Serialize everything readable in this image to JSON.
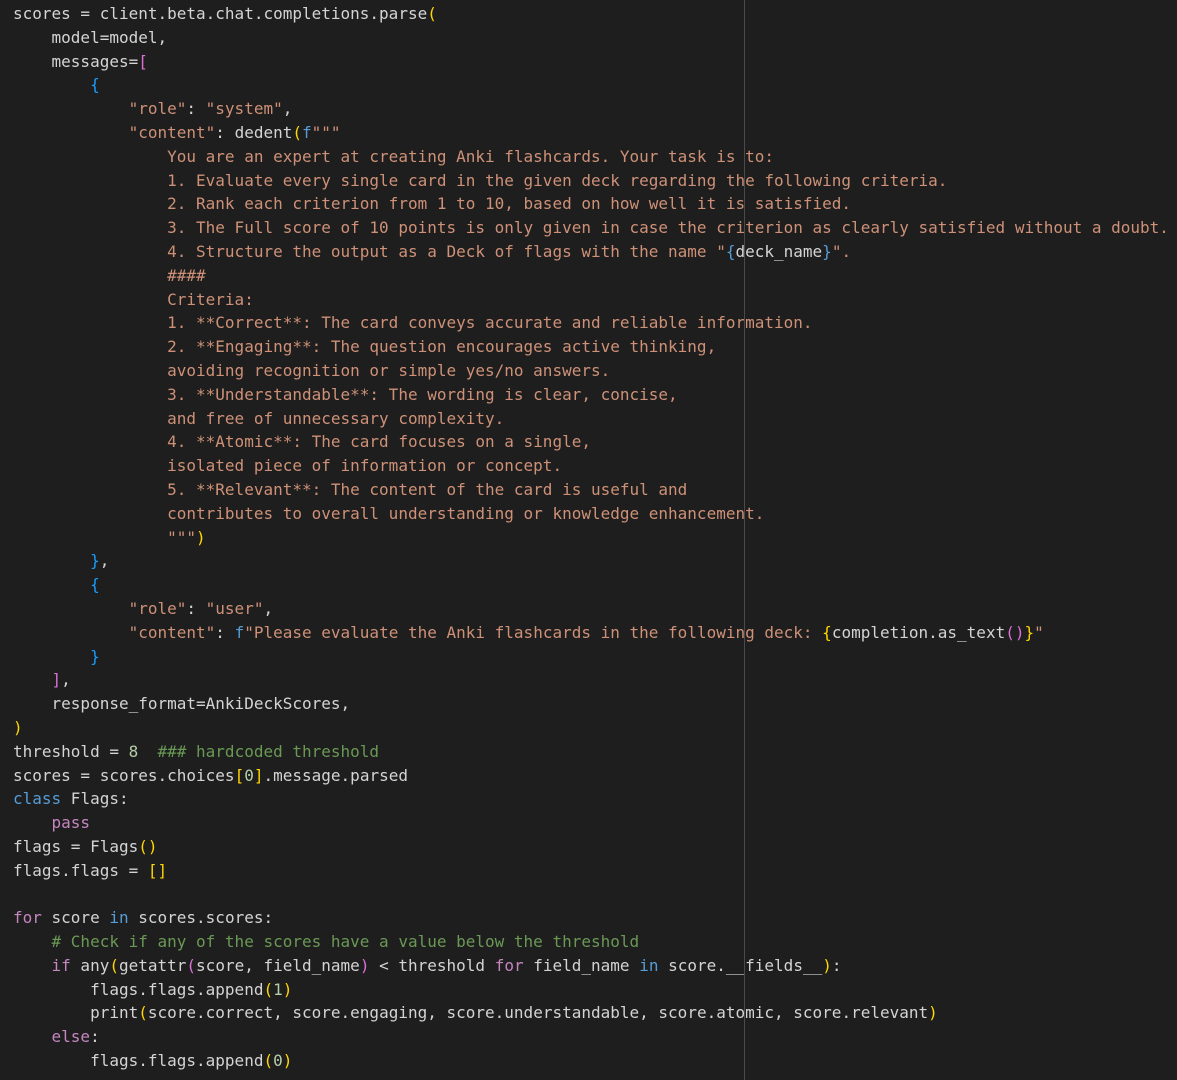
{
  "lines": [
    [
      [
        "t",
        "scores = client.beta.chat.completions.parse"
      ],
      [
        "b1",
        "("
      ]
    ],
    [
      [
        "t",
        "    model=model,"
      ]
    ],
    [
      [
        "t",
        "    messages="
      ],
      [
        "b2",
        "["
      ]
    ],
    [
      [
        "t",
        "        "
      ],
      [
        "b3",
        "{"
      ]
    ],
    [
      [
        "t",
        "            "
      ],
      [
        "s",
        "\"role\""
      ],
      [
        "t",
        ": "
      ],
      [
        "s",
        "\"system\""
      ],
      [
        "t",
        ","
      ]
    ],
    [
      [
        "t",
        "            "
      ],
      [
        "s",
        "\"content\""
      ],
      [
        "t",
        ": dedent"
      ],
      [
        "b1",
        "("
      ],
      [
        "kb",
        "f"
      ],
      [
        "s",
        "\"\"\""
      ]
    ],
    [
      [
        "s",
        "                You are an expert at creating Anki flashcards. Your task is to:"
      ]
    ],
    [
      [
        "s",
        "                1. Evaluate every single card in the given deck regarding the following criteria."
      ]
    ],
    [
      [
        "s",
        "                2. Rank each criterion from 1 to 10, based on how well it is satisfied."
      ]
    ],
    [
      [
        "s",
        "                3. The Full score of 10 points is only given in case the criterion as clearly satisfied without a doubt."
      ]
    ],
    [
      [
        "s",
        "                4. Structure the output as a Deck of flags with the name \""
      ],
      [
        "kb",
        "{"
      ],
      [
        "t",
        "deck_name"
      ],
      [
        "kb",
        "}"
      ],
      [
        "s",
        "\"."
      ]
    ],
    [
      [
        "s",
        "                ####"
      ]
    ],
    [
      [
        "s",
        "                Criteria:"
      ]
    ],
    [
      [
        "s",
        "                1. **Correct**: The card conveys accurate and reliable information."
      ]
    ],
    [
      [
        "s",
        "                2. **Engaging**: The question encourages active thinking,"
      ]
    ],
    [
      [
        "s",
        "                avoiding recognition or simple yes/no answers."
      ]
    ],
    [
      [
        "s",
        "                3. **Understandable**: The wording is clear, concise,"
      ]
    ],
    [
      [
        "s",
        "                and free of unnecessary complexity."
      ]
    ],
    [
      [
        "s",
        "                4. **Atomic**: The card focuses on a single,"
      ]
    ],
    [
      [
        "s",
        "                isolated piece of information or concept."
      ]
    ],
    [
      [
        "s",
        "                5. **Relevant**: The content of the card is useful and"
      ]
    ],
    [
      [
        "s",
        "                contributes to overall understanding or knowledge enhancement."
      ]
    ],
    [
      [
        "s",
        "                \"\"\""
      ],
      [
        "b1",
        ")"
      ]
    ],
    [
      [
        "t",
        "        "
      ],
      [
        "b3",
        "}"
      ],
      [
        "t",
        ","
      ]
    ],
    [
      [
        "t",
        "        "
      ],
      [
        "b3",
        "{"
      ]
    ],
    [
      [
        "t",
        "            "
      ],
      [
        "s",
        "\"role\""
      ],
      [
        "t",
        ": "
      ],
      [
        "s",
        "\"user\""
      ],
      [
        "t",
        ","
      ]
    ],
    [
      [
        "t",
        "            "
      ],
      [
        "s",
        "\"content\""
      ],
      [
        "t",
        ": "
      ],
      [
        "kb",
        "f"
      ],
      [
        "s",
        "\"Please evaluate the Anki flashcards in the following deck: "
      ],
      [
        "b1",
        "{"
      ],
      [
        "t",
        "completion.as_text"
      ],
      [
        "b2",
        "()"
      ],
      [
        "b1",
        "}"
      ],
      [
        "s",
        "\""
      ]
    ],
    [
      [
        "t",
        "        "
      ],
      [
        "b3",
        "}"
      ]
    ],
    [
      [
        "t",
        "    "
      ],
      [
        "b2",
        "]"
      ],
      [
        "t",
        ","
      ]
    ],
    [
      [
        "t",
        "    response_format=AnkiDeckScores,"
      ]
    ],
    [
      [
        "b1",
        ")"
      ]
    ],
    [
      [
        "t",
        "threshold = "
      ],
      [
        "n",
        "8"
      ],
      [
        "t",
        "  "
      ],
      [
        "c",
        "### hardcoded threshold"
      ]
    ],
    [
      [
        "t",
        "scores = scores.choices"
      ],
      [
        "b1",
        "["
      ],
      [
        "n",
        "0"
      ],
      [
        "b1",
        "]"
      ],
      [
        "t",
        ".message.parsed"
      ]
    ],
    [
      [
        "kb",
        "class"
      ],
      [
        "t",
        " Flags:"
      ]
    ],
    [
      [
        "k",
        "    pass"
      ]
    ],
    [
      [
        "t",
        "flags = Flags"
      ],
      [
        "b1",
        "()"
      ]
    ],
    [
      [
        "t",
        "flags.flags = "
      ],
      [
        "b1",
        "[]"
      ]
    ],
    [
      [
        "t",
        ""
      ]
    ],
    [
      [
        "k",
        "for"
      ],
      [
        "t",
        " score "
      ],
      [
        "kb",
        "in"
      ],
      [
        "t",
        " scores.scores:"
      ]
    ],
    [
      [
        "t",
        "    "
      ],
      [
        "c",
        "# Check if any of the scores have a value below the threshold"
      ]
    ],
    [
      [
        "t",
        "    "
      ],
      [
        "k",
        "if"
      ],
      [
        "t",
        " any"
      ],
      [
        "b1",
        "("
      ],
      [
        "t",
        "getattr"
      ],
      [
        "b2",
        "("
      ],
      [
        "t",
        "score, field_name"
      ],
      [
        "b2",
        ")"
      ],
      [
        "t",
        " < threshold "
      ],
      [
        "k",
        "for"
      ],
      [
        "t",
        " field_name "
      ],
      [
        "kb",
        "in"
      ],
      [
        "t",
        " score.__fields__"
      ],
      [
        "b1",
        ")"
      ],
      [
        "t",
        ":"
      ]
    ],
    [
      [
        "t",
        "        flags.flags.append"
      ],
      [
        "b1",
        "("
      ],
      [
        "n",
        "1"
      ],
      [
        "b1",
        ")"
      ]
    ],
    [
      [
        "t",
        "        print"
      ],
      [
        "b1",
        "("
      ],
      [
        "t",
        "score.correct, score.engaging, score.understandable, score.atomic, score.relevant"
      ],
      [
        "b1",
        ")"
      ]
    ],
    [
      [
        "k",
        "    else"
      ],
      [
        "t",
        ":"
      ]
    ],
    [
      [
        "t",
        "        flags.flags.append"
      ],
      [
        "b1",
        "("
      ],
      [
        "n",
        "0"
      ],
      [
        "b1",
        ")"
      ]
    ]
  ]
}
